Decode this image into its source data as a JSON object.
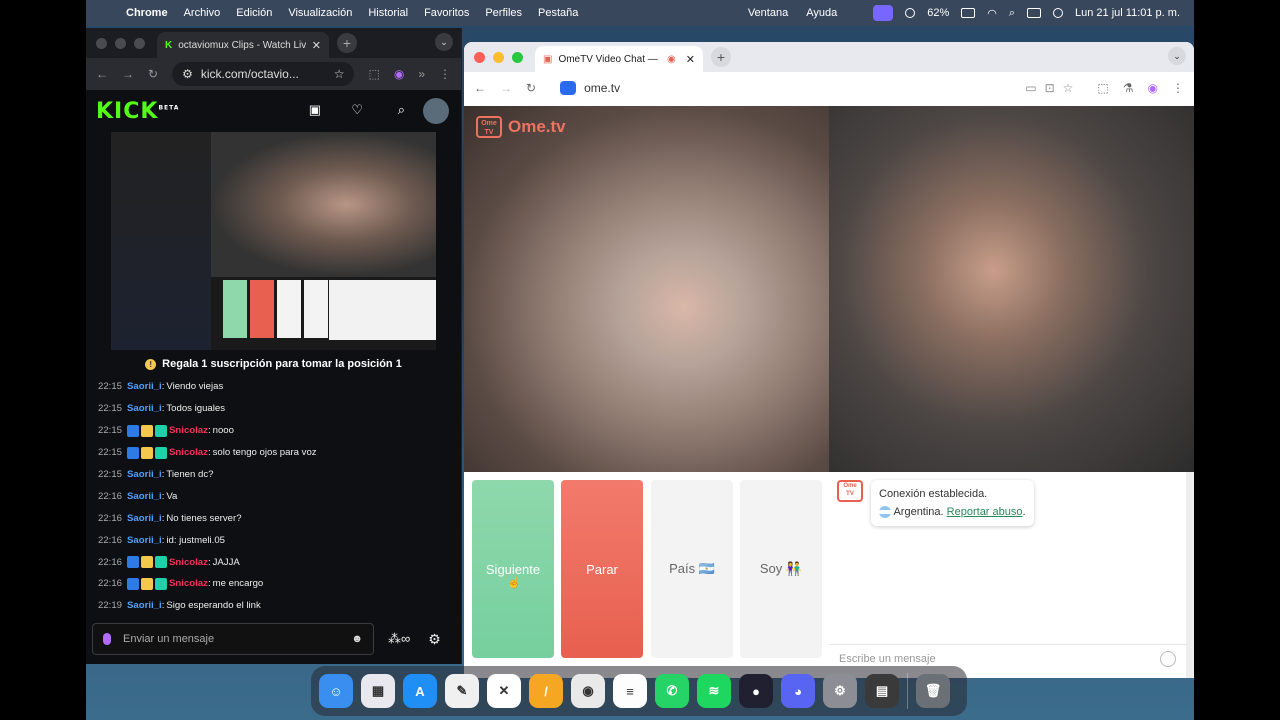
{
  "menubar": {
    "app": "Chrome",
    "items": [
      "Archivo",
      "Edición",
      "Visualización",
      "Historial",
      "Favoritos",
      "Perfiles",
      "Pestaña",
      "Ventana",
      "Ayuda"
    ],
    "battery": "62%",
    "datetime": "Lun 21 jul  11:01 p. m."
  },
  "kick_window": {
    "tab_title": "octaviomux Clips - Watch Liv",
    "url": "kick.com/octavio...",
    "logo": "KICK",
    "logo_beta": "BETA",
    "sub_banner": "Regala 1 suscripción para tomar la posición 1",
    "chat": [
      {
        "time": "22:15",
        "user": "Saorii_i",
        "msg": "Viendo viejas",
        "badges": false,
        "color": "#4ea1ff"
      },
      {
        "time": "22:15",
        "user": "Saorii_i",
        "msg": "Todos iguales",
        "badges": false,
        "color": "#4ea1ff"
      },
      {
        "time": "22:15",
        "user": "Snicolaz",
        "msg": "nooo",
        "badges": true,
        "color": "#ff2e5b"
      },
      {
        "time": "22:15",
        "user": "Snicolaz",
        "msg": "solo tengo ojos para voz",
        "badges": true,
        "color": "#ff2e5b"
      },
      {
        "time": "22:15",
        "user": "Saorii_i",
        "msg": "Tienen dc?",
        "badges": false,
        "color": "#4ea1ff"
      },
      {
        "time": "22:16",
        "user": "Saorii_i",
        "msg": "Va",
        "badges": false,
        "color": "#4ea1ff"
      },
      {
        "time": "22:16",
        "user": "Saorii_i",
        "msg": "No tienes server?",
        "badges": false,
        "color": "#4ea1ff"
      },
      {
        "time": "22:16",
        "user": "Saorii_i",
        "msg": "id: justmeli.05",
        "badges": false,
        "color": "#4ea1ff"
      },
      {
        "time": "22:16",
        "user": "Snicolaz",
        "msg": "JAJJA",
        "badges": true,
        "color": "#ff2e5b"
      },
      {
        "time": "22:16",
        "user": "Snicolaz",
        "msg": "me encargo",
        "badges": true,
        "color": "#ff2e5b"
      },
      {
        "time": "22:19",
        "user": "Saorii_i",
        "msg": "Sigo esperando el link",
        "badges": false,
        "color": "#4ea1ff"
      }
    ],
    "message_placeholder": "Enviar un mensaje"
  },
  "ome_window": {
    "tab_title": "OmeTV Video Chat — Om",
    "url": "ome.tv",
    "logo_text": "Ome.tv",
    "logo_badge": "Ome TV",
    "buttons": {
      "next": "Siguiente",
      "stop": "Parar",
      "country": "País 🇦🇷",
      "gender": "Soy 👫"
    },
    "system_message": {
      "line1": "Conexión establecida.",
      "country": "Argentina.",
      "report": "Reportar abuso"
    },
    "chat_placeholder": "Escribe un mensaje"
  },
  "dock": {
    "apps": [
      {
        "name": "finder-icon",
        "color": "#3a8ef0",
        "label": "☺"
      },
      {
        "name": "launchpad-icon",
        "color": "#e8e8ee",
        "label": "▦"
      },
      {
        "name": "app-store-icon",
        "color": "#1f8ff5",
        "label": "A"
      },
      {
        "name": "notes-pencil-icon",
        "color": "#f0f0f0",
        "label": "✎"
      },
      {
        "name": "capcut-icon",
        "color": "#ffffff",
        "label": "✕"
      },
      {
        "name": "pages-icon",
        "color": "#f5a623",
        "label": "/"
      },
      {
        "name": "chrome-icon",
        "color": "#e9e9e9",
        "label": "◉"
      },
      {
        "name": "notes-icon",
        "color": "#fdfdfd",
        "label": "≡"
      },
      {
        "name": "whatsapp-icon",
        "color": "#25d366",
        "label": "✆"
      },
      {
        "name": "spotify-icon",
        "color": "#1ed760",
        "label": "≋"
      },
      {
        "name": "obs-icon",
        "color": "#202030",
        "label": "●"
      },
      {
        "name": "discord-icon",
        "color": "#5865f2",
        "label": "◕"
      },
      {
        "name": "system-settings-icon",
        "color": "#8d8d95",
        "label": "⚙"
      },
      {
        "name": "calculator-icon",
        "color": "#3a3a3a",
        "label": "▤"
      },
      {
        "name": "trash-icon",
        "color": "#6a7076",
        "label": "🗑"
      }
    ]
  }
}
